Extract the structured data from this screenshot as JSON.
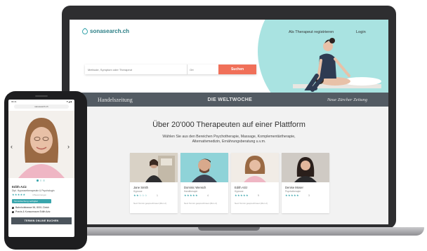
{
  "laptop": {
    "header": {
      "logo_text": "sonasearch.ch",
      "register_link": "Als Therapeut registrieren",
      "login_link": "Login"
    },
    "search": {
      "query_placeholder": "Methode, Symptom oder Therapeut",
      "location_placeholder": "Ort",
      "button_label": "Suchen"
    },
    "press": [
      "Handelszeitung",
      "DIE WELTWOCHE",
      "Neue Zürcher Zeitung"
    ],
    "main": {
      "headline": "Über 20'000 Therapeuten auf einer Plattform",
      "subline": "Wählen Sie aus den Bereichen Psychotherapie, Massage, Komplementärtherapie, Alternativmedizin, Ernährungsberatung u.v.m."
    },
    "therapists": [
      {
        "name": "Jane Smith",
        "role": "Hypnose",
        "stars": "★★☆☆☆",
        "reviews": "1",
        "next": "Next Termin gesprechtneet (Mon 2)"
      },
      {
        "name": "Dominic Wensch",
        "role": "Handtherapie",
        "stars": "★★★★★",
        "reviews": "4",
        "next": "Next Termin gesprechtneet (Mon 2)"
      },
      {
        "name": "Edith Aziz",
        "role": "Hypnose",
        "stars": "★★★★★",
        "reviews": "9",
        "next": "Next Termin gesprechtneet (Mon 2)"
      },
      {
        "name": "Denise Moser",
        "role": "Psychotherapie",
        "stars": "★★★★★",
        "reviews": "3",
        "next": ""
      }
    ]
  },
  "phone": {
    "status_time": "09:41",
    "status_right": "▼◢ ▮",
    "url": "sanesearch.ch",
    "name": "Edith Aziz",
    "role": "Dipl. Hypnosetherapeutin & Psychologin",
    "stars": "★★★★★",
    "reviews": "4 Bewertungen",
    "badge": "Terminbuchung verfügbar",
    "address": "Bahnhofstrasse 56, 8001 Zürich",
    "practice": "Praxis & Konsumraum Edith Aziz",
    "cta": "TERMIN ONLINE BUCHEN"
  },
  "colors": {
    "accent": "#3aa6ad",
    "mint": "#a9e3e1",
    "button": "#f07059",
    "press_bar": "#535b63",
    "cta": "#4b545c"
  }
}
